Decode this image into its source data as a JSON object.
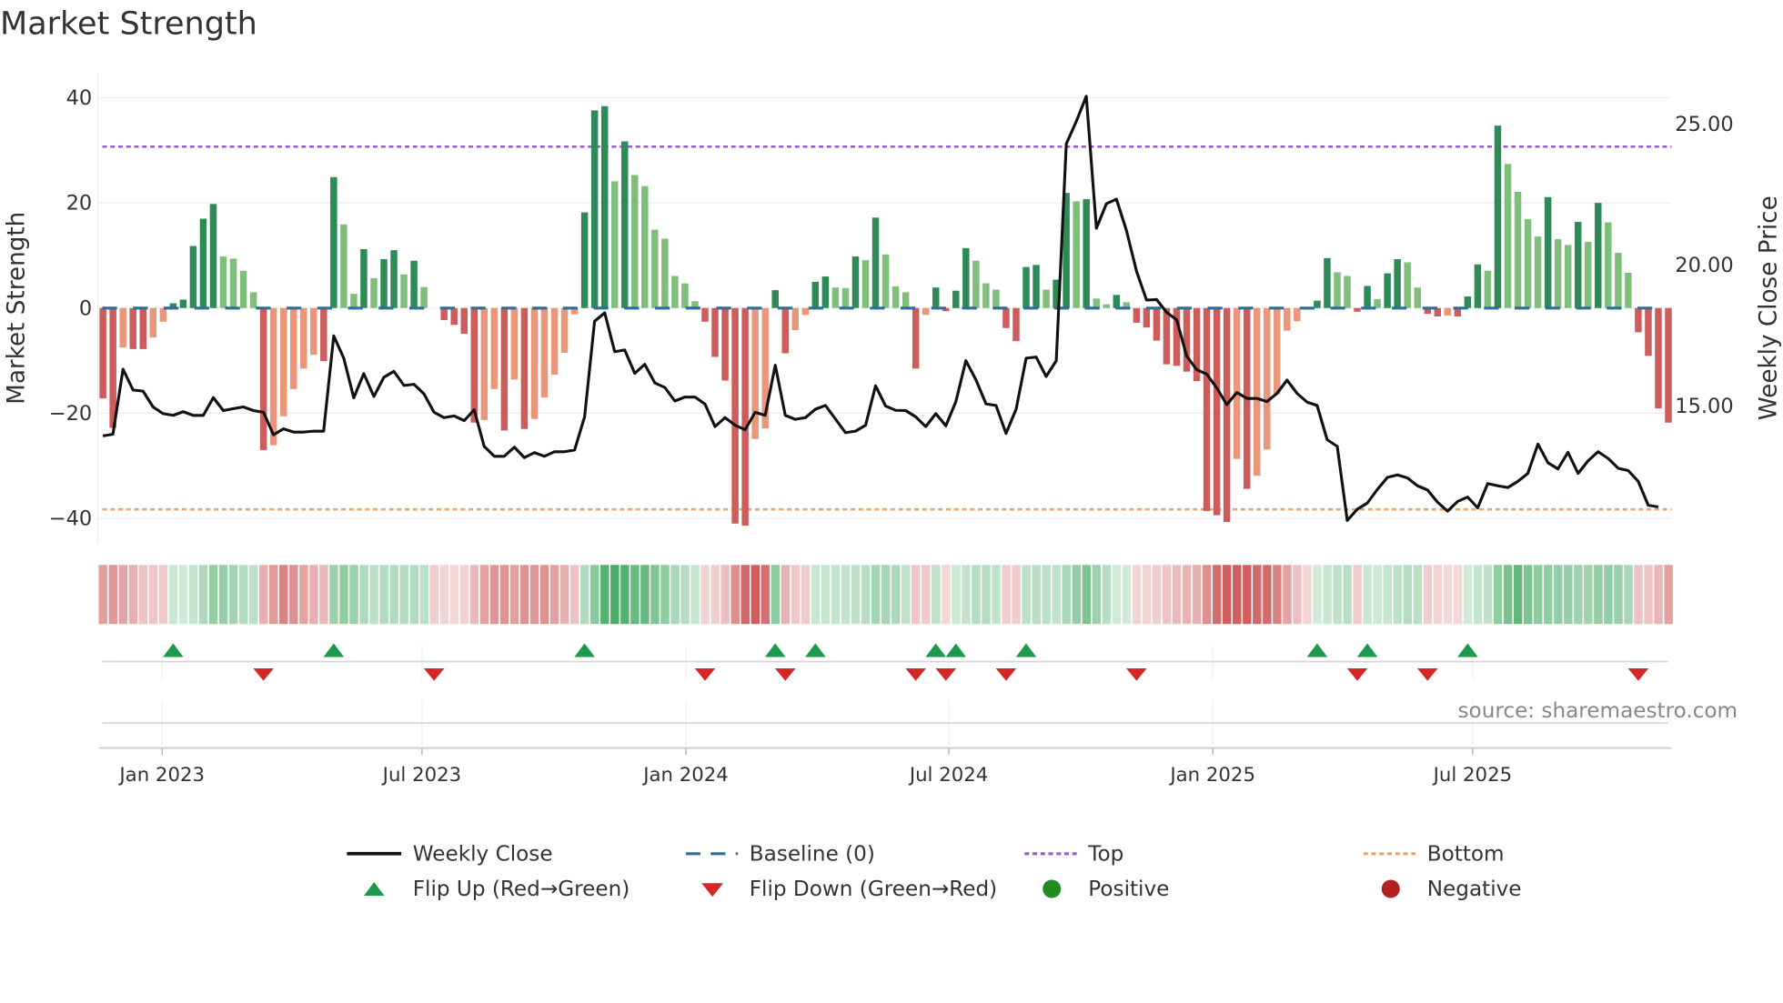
{
  "title": "Market Strength",
  "source": "source: sharemaestro.com",
  "colors": {
    "pos_dark": "#2e8b57",
    "pos_light": "#7fbf7b",
    "neg_dark": "#cd5c5c",
    "neg_light": "#e9967a",
    "baseline": "#2a6f9e",
    "top": "#9b59d0",
    "bottom": "#f0a060",
    "line": "#111111",
    "flip_up": "#1a9a4a",
    "flip_down": "#d62728",
    "positive": "#228b22",
    "negative": "#b22222"
  },
  "legend": {
    "weekly_close": "Weekly Close",
    "baseline": "Baseline (0)",
    "top": "Top",
    "bottom": "Bottom",
    "flip_up": "Flip Up (Red→Green)",
    "flip_down": "Flip Down (Green→Red)",
    "positive": "Positive",
    "negative": "Negative"
  },
  "chart_data": {
    "type": "bar",
    "title": "Market Strength",
    "ylabel": "Market Strength",
    "y2label": "Weekly Close Price",
    "ylim": [
      -44,
      44
    ],
    "y2lim": [
      10.5,
      27.3
    ],
    "yticks": [
      40,
      20,
      0,
      -20,
      -40
    ],
    "ytick_labels": [
      "40",
      "20",
      "0",
      "−20",
      "−40"
    ],
    "y2ticks": [
      25,
      20,
      15
    ],
    "y2tick_labels": [
      "25.00",
      "20.00",
      "15.00"
    ],
    "xtick_labels": [
      "Jan 2023",
      "Jul 2023",
      "Jan 2024",
      "Jul 2024",
      "Jan 2025",
      "Jul 2025"
    ],
    "xtick_week_index": [
      5.9,
      31.8,
      58.1,
      84.3,
      110.6,
      136.5
    ],
    "top_level": 30.7,
    "bottom_level": -38.3,
    "baseline": 0,
    "frequency": "weekly",
    "strength": [
      -17.2,
      -22.8,
      -7.5,
      -7.8,
      -7.8,
      -5.6,
      -2.6,
      0.9,
      1.6,
      11.8,
      17.0,
      19.8,
      9.8,
      9.4,
      7.1,
      3.0,
      -27.0,
      -26.1,
      -20.6,
      -15.4,
      -11.5,
      -8.9,
      -10.1,
      24.9,
      15.9,
      2.7,
      11.2,
      5.7,
      9.3,
      11.0,
      6.4,
      9.0,
      4.0,
      0,
      -2.3,
      -3.2,
      -4.9,
      -21.8,
      -21.3,
      -15.4,
      -23.3,
      -13.6,
      -23.0,
      -21.1,
      -17.0,
      -12.7,
      -8.5,
      -1.2,
      18.2,
      37.6,
      38.4,
      24.1,
      31.7,
      25.3,
      23.2,
      14.9,
      13.2,
      6.1,
      4.7,
      1.3,
      -2.6,
      -9.3,
      -13.8,
      -41.0,
      -41.4,
      -24.9,
      -22.9,
      3.4,
      -8.6,
      -4.2,
      -1.3,
      5.0,
      6.0,
      3.9,
      3.8,
      9.8,
      9.1,
      17.2,
      10.2,
      4.1,
      3.0,
      -11.5,
      -1.3,
      3.9,
      -0.6,
      3.3,
      11.4,
      9.0,
      4.7,
      3.5,
      -3.8,
      -6.3,
      7.8,
      8.2,
      3.5,
      5.4,
      21.9,
      20.3,
      20.7,
      1.8,
      0.7,
      2.5,
      1.1,
      -2.8,
      -3.7,
      -6.2,
      -10.7,
      -11.0,
      -12.1,
      -13.9,
      -38.6,
      -39.4,
      -40.7,
      -28.7,
      -34.4,
      -31.9,
      -26.9,
      -16.4,
      -4.3,
      -2.5,
      -0.3,
      1.4,
      9.5,
      6.8,
      6.1,
      -0.7,
      4.2,
      1.7,
      6.6,
      9.3,
      8.7,
      3.9,
      -1.1,
      -1.6,
      -1.4,
      -1.6,
      2.2,
      8.3,
      7.1,
      34.7,
      27.4,
      22.1,
      16.9,
      13.6,
      21.1,
      13.1,
      12.0,
      16.4,
      12.6,
      20.0,
      16.3,
      10.5,
      6.7,
      -4.6,
      -9.1,
      -19.1,
      -21.8
    ],
    "weekly_close": [
      13.89,
      13.95,
      16.26,
      15.52,
      15.48,
      14.92,
      14.68,
      14.62,
      14.75,
      14.62,
      14.62,
      15.25,
      14.79,
      14.86,
      14.92,
      14.79,
      14.73,
      13.93,
      14.14,
      14.03,
      14.03,
      14.06,
      14.06,
      17.44,
      16.65,
      15.24,
      16.1,
      15.29,
      15.97,
      16.18,
      15.68,
      15.72,
      15.38,
      14.73,
      14.54,
      14.6,
      14.43,
      14.82,
      13.52,
      13.17,
      13.17,
      13.49,
      13.12,
      13.3,
      13.17,
      13.33,
      13.33,
      13.39,
      14.57,
      17.96,
      18.26,
      16.88,
      16.94,
      16.11,
      16.43,
      15.77,
      15.61,
      15.13,
      15.27,
      15.27,
      15.02,
      14.22,
      14.54,
      14.27,
      14.11,
      14.73,
      14.62,
      16.4,
      14.62,
      14.48,
      14.54,
      14.84,
      14.97,
      14.49,
      14.01,
      14.06,
      14.27,
      15.67,
      14.95,
      14.8,
      14.79,
      14.57,
      14.22,
      14.68,
      14.25,
      15.11,
      16.56,
      15.88,
      15.03,
      14.97,
      13.98,
      14.84,
      16.65,
      16.69,
      16.0,
      16.56,
      24.25,
      25.05,
      25.94,
      21.26,
      22.13,
      22.29,
      21.18,
      19.73,
      18.71,
      18.73,
      18.28,
      18.01,
      16.72,
      16.24,
      16.08,
      15.59,
      15.0,
      15.43,
      15.22,
      15.22,
      15.11,
      15.4,
      15.87,
      15.4,
      15.09,
      14.97,
      13.76,
      13.52,
      10.89,
      11.29,
      11.51,
      11.99,
      12.42,
      12.51,
      12.4,
      12.12,
      11.97,
      11.54,
      11.22,
      11.57,
      11.72,
      11.34,
      12.2,
      12.12,
      12.06,
      12.28,
      12.56,
      13.6,
      12.94,
      12.72,
      13.31,
      12.56,
      13.01,
      13.33,
      13.09,
      12.74,
      12.66,
      12.28,
      11.43,
      11.37
    ],
    "legend_position": "bottom",
    "grid": true
  }
}
